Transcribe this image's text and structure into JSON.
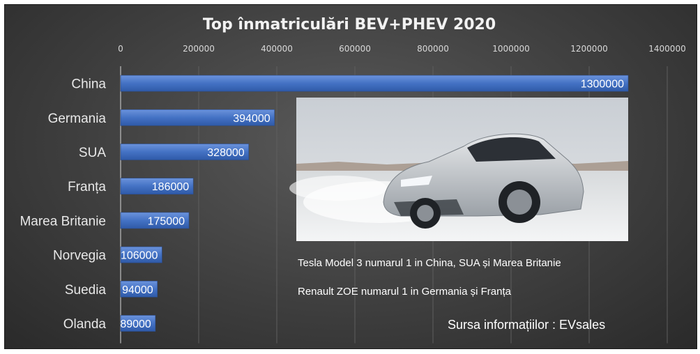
{
  "chart_data": {
    "type": "bar",
    "orientation": "horizontal",
    "title": "Top înmatriculări BEV+PHEV 2020",
    "categories": [
      "China",
      "Germania",
      "SUA",
      "Franța",
      "Marea Britanie",
      "Norvegia",
      "Suedia",
      "Olanda"
    ],
    "values": [
      1300000,
      394000,
      328000,
      186000,
      175000,
      106000,
      94000,
      89000
    ],
    "data_labels": [
      "1300000",
      "394000",
      "328000",
      "186000",
      "175000",
      "106000",
      "94000",
      "89000"
    ],
    "xlim": [
      0,
      1400000
    ],
    "x_ticks": [
      "0",
      "200000",
      "400000",
      "600000",
      "800000",
      "1000000",
      "1200000",
      "1400000"
    ],
    "grid": "vertical",
    "bar_color": "#4472c4",
    "annotations": [
      "Tesla Model 3 numarul 1 in China, SUA și Marea Britanie",
      "Renault ZOE numarul 1 in Germania și Franța"
    ],
    "source": "Sursa informațiilor : EVsales"
  }
}
